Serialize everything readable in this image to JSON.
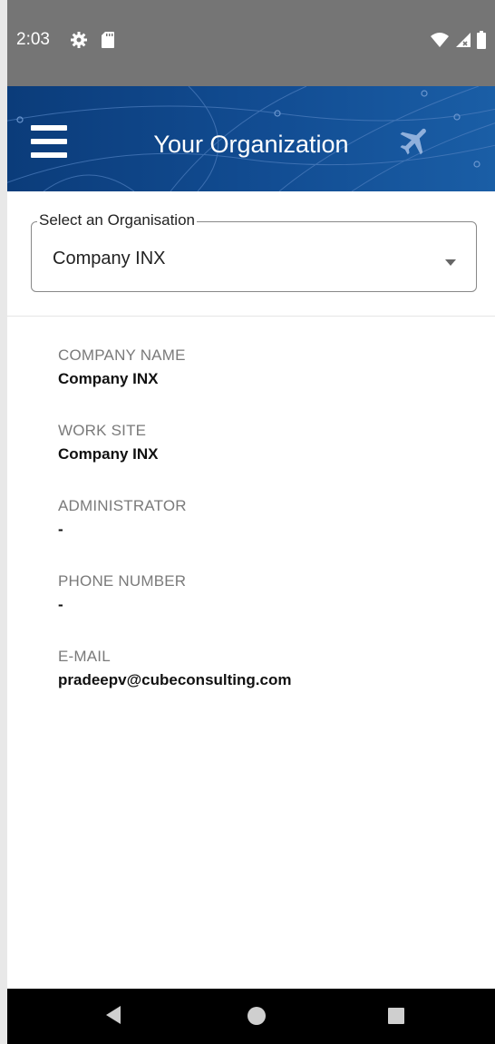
{
  "status_bar": {
    "time": "2:03",
    "icons": [
      "gear-icon",
      "sd-card-icon",
      "wifi-icon",
      "signal-icon",
      "battery-icon"
    ]
  },
  "app_bar": {
    "title": "Your Organization",
    "menu_icon": "hamburger-menu-icon",
    "plane_icon": "airplane-icon",
    "background_color": "#124d93"
  },
  "organisation_select": {
    "label": "Select an Organisation",
    "value": "Company INX"
  },
  "details": [
    {
      "label": "COMPANY NAME",
      "value": "Company INX"
    },
    {
      "label": "WORK SITE",
      "value": "Company INX"
    },
    {
      "label": "ADMINISTRATOR",
      "value": "-"
    },
    {
      "label": "PHONE NUMBER",
      "value": "-"
    },
    {
      "label": "E-MAIL",
      "value": "pradeepv@cubeconsulting.com"
    }
  ],
  "nav_bar": {
    "icons": [
      "back-icon",
      "home-icon",
      "recents-icon"
    ]
  }
}
